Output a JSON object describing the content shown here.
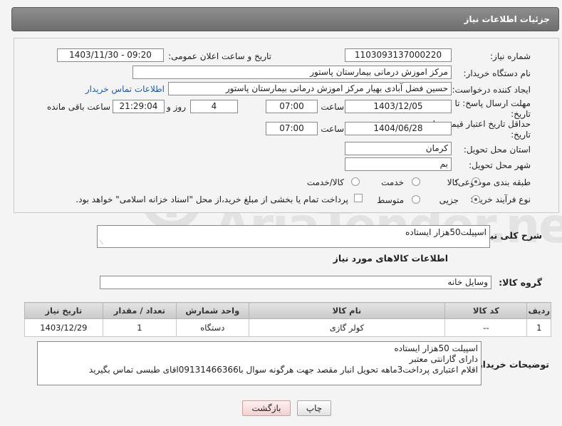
{
  "header": {
    "title": "جزئیات اطلاعات نیاز"
  },
  "labels": {
    "need_number": "شماره نیاز:",
    "announce_datetime": "تاریخ و ساعت اعلان عمومی:",
    "buyer_org": "نام دستگاه خریدار:",
    "requester": "ایجاد کننده درخواست:",
    "contact_link": "اطلاعات تماس خریدار",
    "reply_deadline_1": "مهلت ارسال پاسخ: تا",
    "reply_deadline_2": "تاریخ:",
    "time": "ساعت",
    "days_and": "روز و",
    "time_remaining": "ساعت باقی مانده",
    "min_price_validity_1": "حداقل تاریخ اعتبار قیمت: تا",
    "min_price_validity_2": "تاریخ:",
    "delivery_province": "استان محل تحویل:",
    "delivery_city": "شهر محل تحویل:",
    "subject_class": "طبقه بندی موضوعی:",
    "purchase_process": "نوع فرآیند خرید :",
    "general_description": "شرح کلی نیاز:",
    "goods_info_title": "اطلاعات کالاهای مورد نیاز",
    "goods_group": "گروه کالا:",
    "buyer_notes": "توضیحات خریدار:"
  },
  "values": {
    "need_number": "1103093137000220",
    "announce_datetime": "1403/11/30 - 09:20",
    "buyer_org": "مرکز اموزش درمانی بیمارستان پاستور",
    "requester": "حسین فضل آبادی بهیار مرکز اموزش درمانی بیمارستان پاستور",
    "reply_date": "1403/12/05",
    "reply_time": "07:00",
    "days": "4",
    "remaining_time": "21:29:04",
    "price_validity_date": "1404/06/28",
    "price_validity_time": "07:00",
    "province": "کرمان",
    "city": "بم",
    "general_description": "اسپیلت50هزار ایستاده",
    "goods_group": "وسایل خانه"
  },
  "subject_options": [
    {
      "label": "کالا",
      "selected": true
    },
    {
      "label": "خدمت",
      "selected": false
    },
    {
      "label": "کالا/خدمت",
      "selected": false
    }
  ],
  "process_options": [
    {
      "label": "جزیی",
      "selected": true
    },
    {
      "label": "متوسط",
      "selected": false
    }
  ],
  "treasury_note": "پرداخت تمام یا بخشی از مبلغ خرید،از محل \"اسناد خزانه اسلامی\" خواهد بود.",
  "table": {
    "headers": [
      "ردیف",
      "کد کالا",
      "نام کالا",
      "واحد شمارش",
      "تعداد / مقدار",
      "تاریخ نیاز"
    ],
    "rows": [
      [
        "1",
        "--",
        "کولر گازی",
        "دستگاه",
        "1",
        "1403/12/29"
      ]
    ]
  },
  "buyer_notes_lines": [
    "اسپیلت 50هزار ایستاده",
    "دارای گارانتی معتبر",
    "اقلام اعتباری پرداخت3ماهه تحویل انبار مقصد جهت هرگونه سوال با09131466366اقای طبسی تماس بگیرید"
  ],
  "buttons": {
    "print": "چاپ",
    "back": "بازگشت"
  },
  "watermark": "AriaTender.neT",
  "colors": {
    "link": "#1d5aa8",
    "header_bg": "#7d7d7d"
  }
}
